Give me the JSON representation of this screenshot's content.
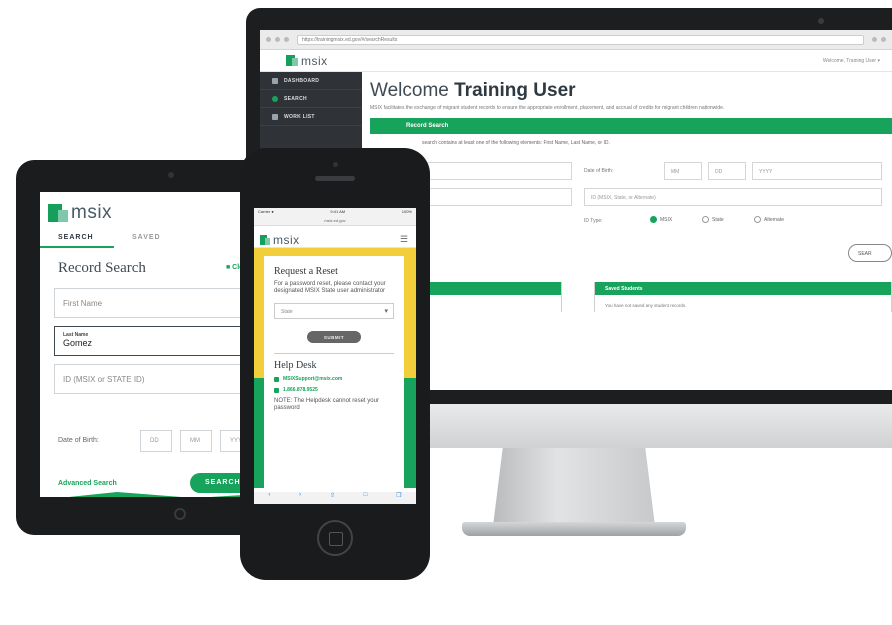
{
  "desktop": {
    "browser": {
      "tab": "MSIX",
      "url": "https://trainingmsix.ed.gov/#/searchResults"
    },
    "logo": "msix",
    "header_user": "Welcome, Training User ▾",
    "sidebar": [
      {
        "label": "DASHBOARD"
      },
      {
        "label": "SEARCH"
      },
      {
        "label": "WORK LIST"
      }
    ],
    "welcome_prefix": "Welcome",
    "welcome_name": "Training User",
    "welcome_sub": "MSIX facilitates the exchange of migrant student records to ensure the appropriate enrollment, placement, and accrual of credits for migrant children nationwide.",
    "record_search_title": "Record Search",
    "record_search_hint": "search contains at least one of the following elements: First Name, Last Name, or ID.",
    "dob_label": "Date of Birth:",
    "dob_placeholders": [
      "MM",
      "DD",
      "YYYY"
    ],
    "id_placeholder": "ID (MSIX, State, or Alternate)",
    "id_type_label": "ID Type:",
    "id_types": [
      "MSIX",
      "State",
      "Alternate"
    ],
    "search_button": "SEAR",
    "panels": [
      {
        "title": "",
        "body": "ing data requests."
      },
      {
        "title": "Saved Students",
        "body": "You have not saved any student records."
      }
    ]
  },
  "tablet": {
    "logo": "msix",
    "tabs": [
      "SEARCH",
      "SAVED"
    ],
    "title": "Record Search",
    "clear": "■ Clea",
    "first_name_placeholder": "First Name",
    "last_name_label": "Last Name",
    "last_name_value": "Gomez",
    "id_placeholder": "ID (MSIX or STATE ID)",
    "dob_label": "Date of Birth:",
    "dob_placeholders": [
      "DD",
      "MM",
      "YYYY"
    ],
    "advanced_search": "Advanced Search",
    "search_button": "SEARCH"
  },
  "phone": {
    "status_left": "Carrier ●",
    "status_time": "9:41 AM",
    "status_right": "100%",
    "url": "msix.ed.gov",
    "logo": "msix",
    "reset_title": "Request a Reset",
    "reset_text": "For a password reset, please contact your designated MSIX State user administrator",
    "state_placeholder": "State",
    "submit": "SUBMIT",
    "help_title": "Help Desk",
    "help_email": "MSIXSupport@msix.com",
    "help_phone": "1.866.878.9525",
    "help_note": "NOTE: The Helpdesk cannot reset your password"
  },
  "colors": {
    "accent": "#17a35c",
    "yellow": "#f2cf3a",
    "dark": "#2f3338"
  }
}
